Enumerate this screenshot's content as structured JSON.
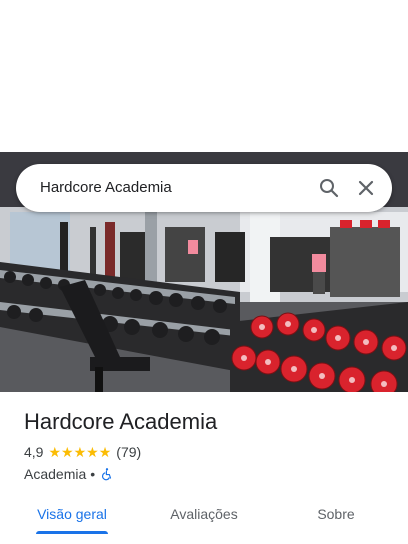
{
  "search": {
    "query": "Hardcore Academia"
  },
  "place": {
    "name": "Hardcore Academia",
    "rating": "4,9",
    "stars": 5,
    "review_count": "(79)",
    "category": "Academia",
    "separator": "•"
  },
  "tabs": [
    {
      "label": "Visão geral",
      "active": true
    },
    {
      "label": "Avaliações",
      "active": false
    },
    {
      "label": "Sobre",
      "active": false
    }
  ],
  "colors": {
    "accent": "#1a73e8",
    "star": "#fbbc04",
    "dumbbell_red": "#d9232d"
  },
  "icons": {
    "search": "search-icon",
    "close": "close-icon",
    "accessibility": "wheelchair-icon",
    "star": "star-icon"
  }
}
